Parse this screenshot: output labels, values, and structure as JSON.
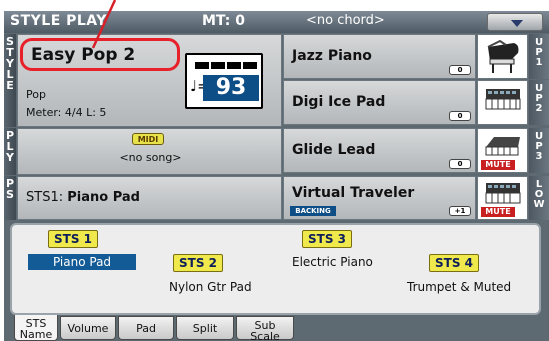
{
  "title_bar": {
    "mode": "STYLE PLAY",
    "mt": "MT: 0",
    "chord": "<no chord>"
  },
  "left_tabs": {
    "style": "STYLE",
    "ply": "PLY",
    "ps": "PS"
  },
  "style_panel": {
    "name": "Easy Pop 2",
    "category": "Pop",
    "meter": "Meter: 4/4  L: 5",
    "tempo": "93",
    "tempo_note": "♩="
  },
  "midi_panel": {
    "badge": "MIDI",
    "song": "<no song>"
  },
  "pad_panel": {
    "prefix": "STS1:",
    "name": "Piano Pad"
  },
  "sounds": [
    {
      "name": "Jazz Piano",
      "octave": "0",
      "icon": "grand-piano-icon",
      "tab": "UP1",
      "muted": false
    },
    {
      "name": "Digi Ice Pad",
      "octave": "0",
      "icon": "keyboard-synth-icon",
      "tab": "UP2",
      "muted": false
    },
    {
      "name": "Glide Lead",
      "octave": "0",
      "icon": "keyboard-synth-icon",
      "tab": "UP3",
      "muted": true
    },
    {
      "name": "Virtual Traveler",
      "octave": "+1",
      "icon": "keyboard-synth-icon",
      "tab": "LOW",
      "muted": true,
      "badge": "BACKING"
    }
  ],
  "mute_label": "MUTE",
  "sts": {
    "buttons": [
      "STS 1",
      "STS 2",
      "STS 3",
      "STS 4"
    ],
    "names": [
      "Piano Pad",
      "Nylon Gtr Pad",
      "Electric Piano",
      "Trumpet & Muted"
    ],
    "selected": "STS 1"
  },
  "tabs": [
    {
      "label": "STS Name",
      "active": true
    },
    {
      "label": "Volume",
      "active": false
    },
    {
      "label": "Pad",
      "active": false
    },
    {
      "label": "Split",
      "active": false
    },
    {
      "label": "Sub Scale",
      "active": false
    }
  ],
  "colors": {
    "highlight_red": "#e8202a",
    "sts_yellow": "#f0e94c",
    "tempo_blue": "#0e4e86",
    "mute_red": "#c82020"
  }
}
